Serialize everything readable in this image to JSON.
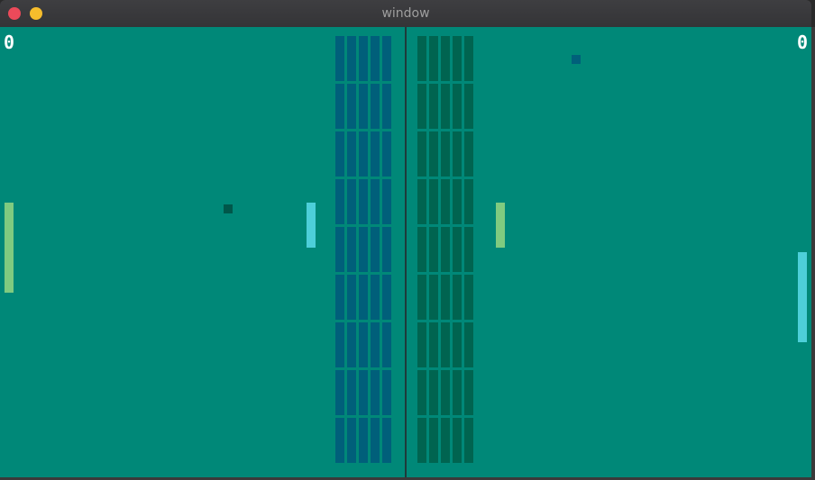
{
  "window": {
    "title": "window",
    "close_color": "#ec4a5a",
    "minimize_color": "#f6bd2c"
  },
  "game": {
    "background_color": "#008878",
    "divider_color": "#1f3a3a",
    "score_color": "#ffffff",
    "left_score": "0",
    "right_score": "0",
    "brick_rows": 9,
    "brick_cols": 5,
    "left_wall_color": "#005f7a",
    "right_wall_color": "#006450",
    "paddle_green": "#7fcb80",
    "paddle_cyan": "#4dcfd9",
    "ball_dark": "#00574a",
    "ball_blue": "#00607a"
  }
}
